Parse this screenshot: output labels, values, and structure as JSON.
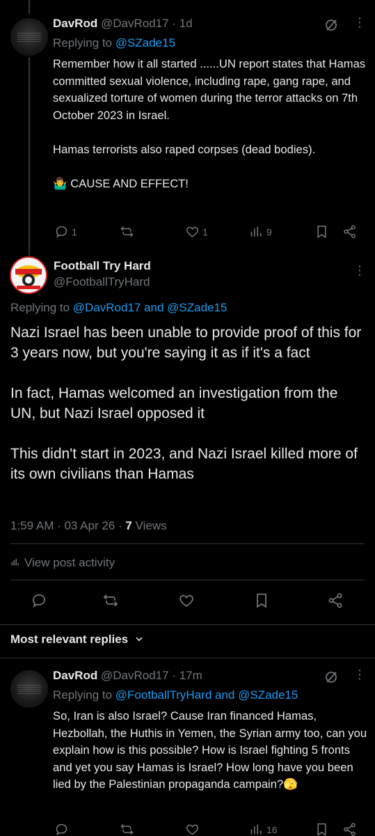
{
  "post1": {
    "display_name": "DavRod",
    "handle": "@DavRod17",
    "time": "1d",
    "replying_label": "Replying to ",
    "replying_handles": "@SZade15",
    "text": "Remember how it all started ......UN report states that Hamas committed sexual violence, including rape, gang rape, and sexualized torture of women during the terror attacks on 7th October 2023 in Israel.\n\nHamas terrorists also raped corpses (dead bodies).\n\n🤷‍♂️ CAUSE AND EFFECT!",
    "replies": "1",
    "likes": "1",
    "views": "9"
  },
  "main_post": {
    "display_name": "Football Try Hard",
    "handle": "@FootballTryHard",
    "replying_label": "Replying to ",
    "replying_handles": "@DavRod17 and @SZade15",
    "text": "Nazi Israel has been unable to provide proof of this for 3 years now, but you're saying it as if it's a fact\n\nIn fact, Hamas welcomed an investigation from the UN, but Nazi Israel opposed it\n\nThis didn't start in 2023, and Nazi Israel killed more of its own civilians than Hamas",
    "timestamp": "1:59 AM · 03 Apr 26 · ",
    "views_count": "7",
    "views_label": " Views",
    "activity_label": "View post activity"
  },
  "sort": {
    "label": "Most relevant replies"
  },
  "post3": {
    "display_name": "DavRod",
    "handle": "@DavRod17",
    "time": "17m",
    "replying_label": "Replying to ",
    "replying_handles": "@FootballTryHard and @SZade15",
    "text": "So, Iran is also Israel? Cause Iran financed Hamas, Hezbollah, the Huthis in Yemen, the Syrian army too, can you explain how is this possible? How is Israel fighting 5 fronts and yet you say Hamas is Israel? How long have you been lied by the Palestinian propaganda campain?🫣",
    "views": "16"
  }
}
